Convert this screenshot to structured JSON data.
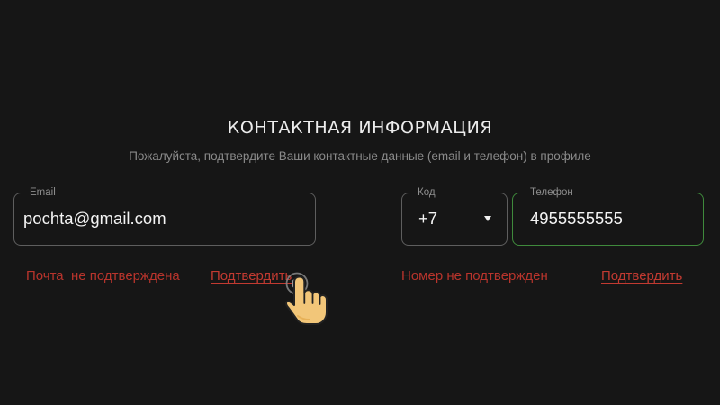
{
  "page": {
    "title": "КОНТАКТНАЯ ИНФОРМАЦИЯ",
    "subtitle": "Пожалуйста, подтвердите Ваши контактные данные (email и телефон) в профиле"
  },
  "email": {
    "label": "Email",
    "value": "pochta@gmail.com",
    "status": "Почта  не подтверждена",
    "confirm_label": "Подтвердить"
  },
  "phone": {
    "code_label": "Код",
    "code_value": "+7",
    "label": "Телефон",
    "value": "4955555555",
    "status": "Номер не подтвержден",
    "confirm_label": "Подтвердить"
  },
  "colors": {
    "background": "#161616",
    "error_text": "#b8342c",
    "phone_border": "#3f8a3c",
    "field_border": "#5e5e5e"
  },
  "icons": {
    "cursor": "hand-pointer-icon",
    "dropdown": "chevron-down-icon"
  }
}
